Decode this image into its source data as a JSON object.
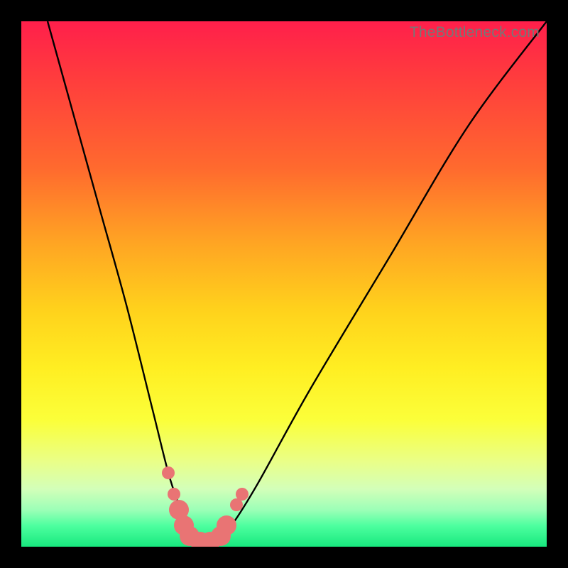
{
  "watermark": "TheBottleneck.com",
  "chart_data": {
    "type": "line",
    "title": "",
    "xlabel": "",
    "ylabel": "",
    "xlim": [
      0,
      100
    ],
    "ylim": [
      0,
      100
    ],
    "series": [
      {
        "name": "bottleneck-curve",
        "x": [
          5,
          10,
          15,
          20,
          25,
          28,
          30,
          32,
          34,
          36,
          38,
          40,
          45,
          55,
          70,
          85,
          100
        ],
        "y": [
          100,
          82,
          64,
          46,
          26,
          14,
          8,
          3,
          1,
          1,
          2,
          4,
          12,
          30,
          55,
          80,
          100
        ]
      }
    ],
    "markers": {
      "name": "highlight-region",
      "color": "#e97474",
      "points": [
        {
          "x": 28,
          "y": 14,
          "size": "small"
        },
        {
          "x": 29,
          "y": 10,
          "size": "small"
        },
        {
          "x": 30,
          "y": 7,
          "size": "big"
        },
        {
          "x": 31,
          "y": 4,
          "size": "big"
        },
        {
          "x": 32,
          "y": 2,
          "size": "big"
        },
        {
          "x": 34,
          "y": 1,
          "size": "big"
        },
        {
          "x": 36,
          "y": 1,
          "size": "big"
        },
        {
          "x": 38,
          "y": 2,
          "size": "big"
        },
        {
          "x": 39,
          "y": 4,
          "size": "big"
        },
        {
          "x": 41,
          "y": 8,
          "size": "small"
        },
        {
          "x": 42,
          "y": 10,
          "size": "small"
        }
      ]
    },
    "background_gradient": {
      "top": "#ff1f4b",
      "bottom": "#18e87e",
      "type": "vertical"
    }
  }
}
